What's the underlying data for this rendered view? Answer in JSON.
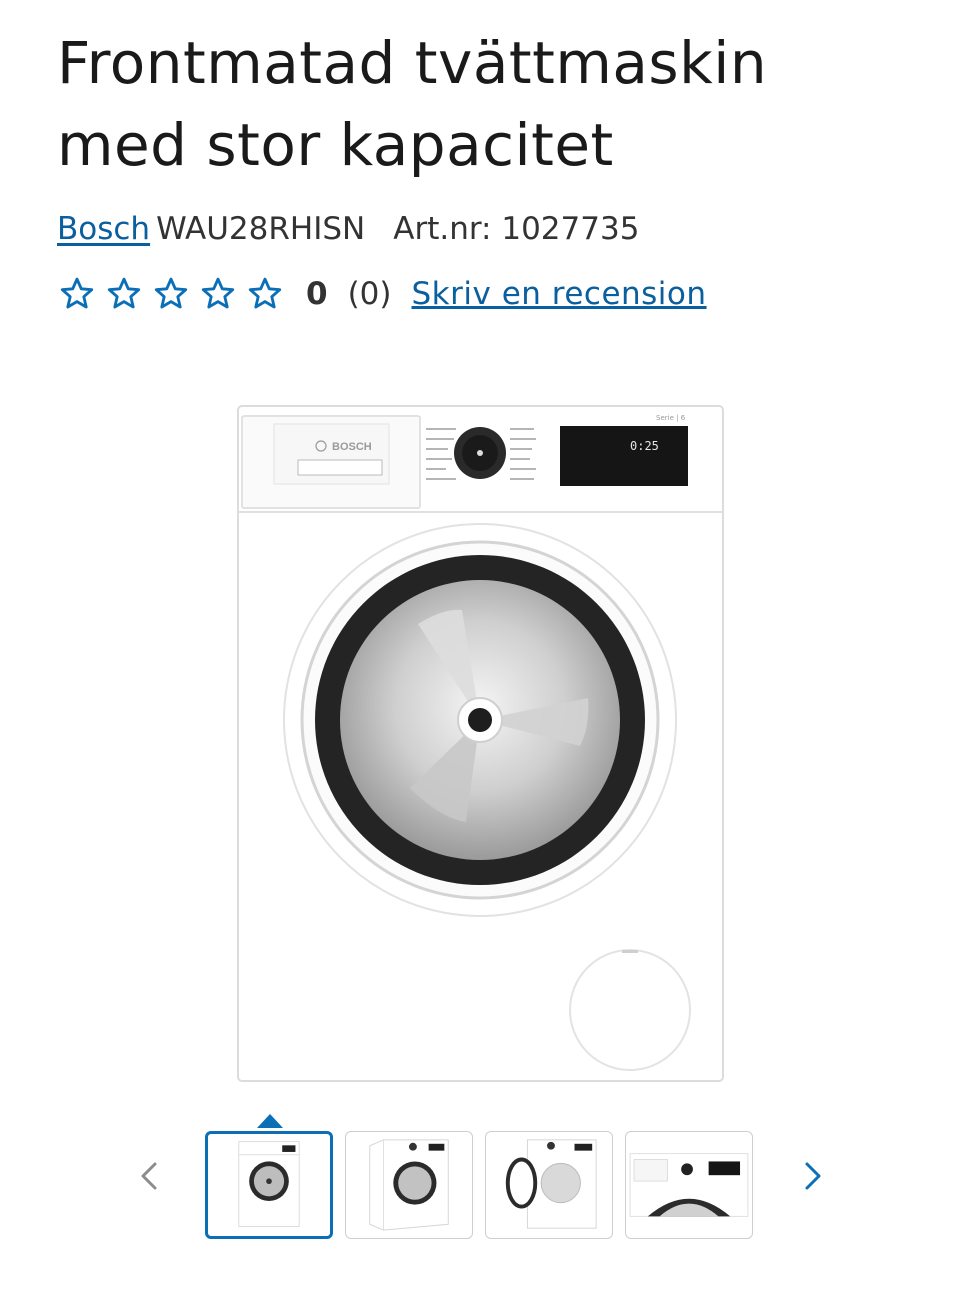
{
  "product": {
    "title_line1": "Frontmatad tvättmaskin",
    "title_line2": "med stor kapacitet",
    "brand": "Bosch",
    "model": "WAU28RHISN",
    "article_number": "Art.nr: 1027735"
  },
  "rating": {
    "score": "0",
    "count": "(0)",
    "write_review": "Skriv en recension",
    "stars_filled": 0,
    "stars_total": 5
  },
  "image": {
    "badge": "BOSCH",
    "display": "0:25",
    "series": "Serie | 6"
  },
  "gallery": {
    "active_index": 0,
    "thumbnails": [
      "front-view",
      "angled-view",
      "open-door-view",
      "control-panel-closeup"
    ]
  },
  "colors": {
    "link": "#0a5f9e",
    "accent": "#0a6fb6"
  }
}
